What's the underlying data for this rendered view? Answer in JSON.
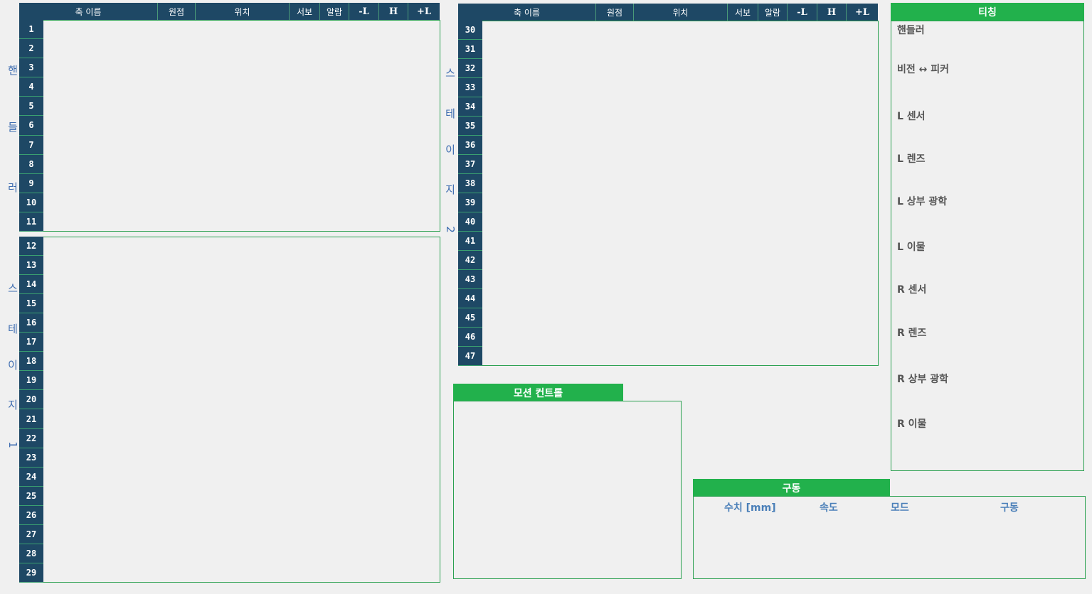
{
  "table_header": {
    "axis_name": "축 이름",
    "origin": "원점",
    "position": "위치",
    "servo": "서보",
    "alarm": "알람",
    "minus_limit": "-L",
    "home": "H",
    "plus_limit": "+L"
  },
  "groups": {
    "handler": [
      "핸",
      "들",
      "러"
    ],
    "stage1": [
      "스",
      "테",
      "이",
      "지",
      "1"
    ],
    "stage2": [
      "스",
      "테",
      "이",
      "지",
      "2"
    ]
  },
  "axes_handler": [
    "1",
    "2",
    "3",
    "4",
    "5",
    "6",
    "7",
    "8",
    "9",
    "10",
    "11"
  ],
  "axes_stage1": [
    "12",
    "13",
    "14",
    "15",
    "16",
    "17",
    "18",
    "19",
    "20",
    "21",
    "22",
    "23",
    "24",
    "25",
    "26",
    "27",
    "28",
    "29"
  ],
  "axes_stage2": [
    "30",
    "31",
    "32",
    "33",
    "34",
    "35",
    "36",
    "37",
    "38",
    "39",
    "40",
    "41",
    "42",
    "43",
    "44",
    "45",
    "46",
    "47"
  ],
  "motion_control": {
    "title": "모션 컨트롤"
  },
  "teaching": {
    "title": "티칭",
    "items": [
      "핸들러",
      "비전 ↔ 피커",
      "L 센서",
      "L 렌즈",
      "L 상부 광학",
      "L 이물",
      "R 센서",
      "R 렌즈",
      "R 상부 광학",
      "R 이물"
    ]
  },
  "drive": {
    "title": "구동",
    "columns": [
      "수치 [mm]",
      "속도",
      "모드",
      "구동"
    ]
  },
  "colors": {
    "header_bg": "#1e4865",
    "accent_green": "#22b14c",
    "label_blue": "#3d6cb0"
  }
}
